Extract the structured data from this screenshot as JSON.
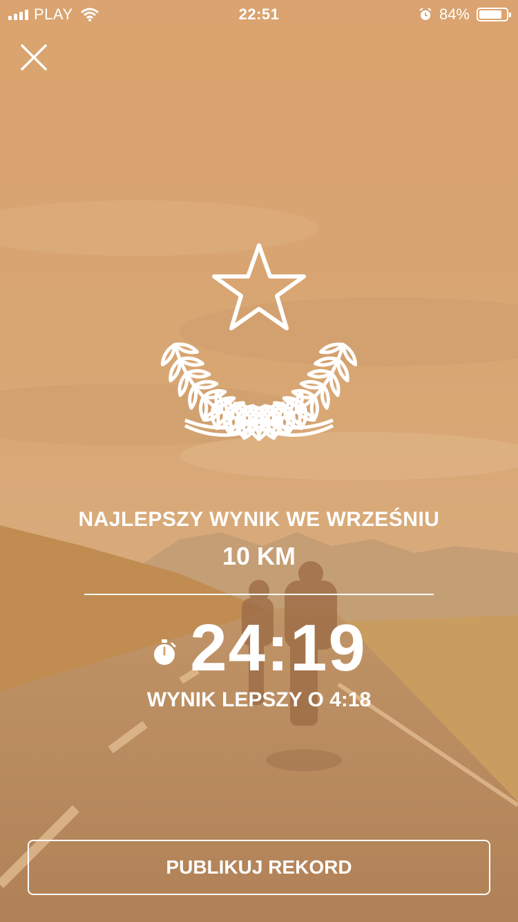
{
  "status_bar": {
    "carrier": "PLAY",
    "time": "22:51",
    "battery_percent": "84%",
    "battery_level": 0.84,
    "icons": [
      "signal-icon",
      "wifi-icon",
      "alarm-icon",
      "battery-icon"
    ]
  },
  "header": {
    "close_icon": "close-icon"
  },
  "achievement": {
    "icon": "laurel-star-icon",
    "title": "NAJLEPSZY WYNIK WE WRZEŚNIU",
    "distance": "10 KM",
    "time": "24:19",
    "time_icon": "stopwatch-icon",
    "improvement": "WYNIK LEPSZY O 4:18"
  },
  "actions": {
    "publish_label": "PUBLIKUJ REKORD"
  },
  "colors": {
    "overlay": "#d9a46c",
    "sky_top": "#dba572",
    "road": "#a97d55",
    "text": "#ffffff"
  }
}
